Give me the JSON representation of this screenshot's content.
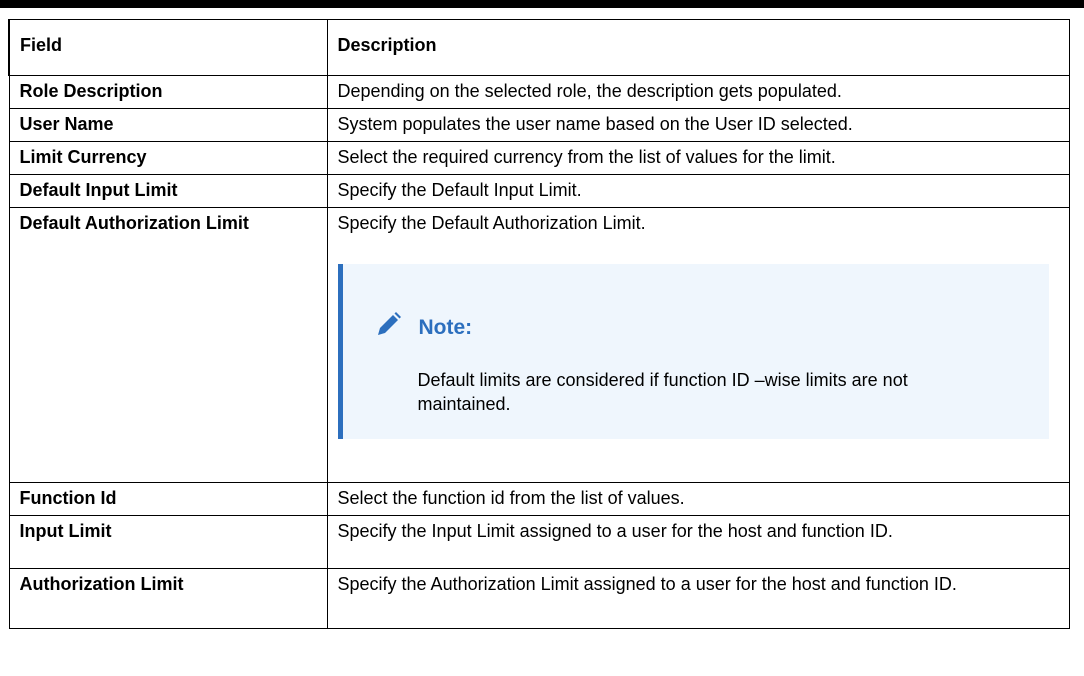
{
  "table": {
    "headers": {
      "field": "Field",
      "description": "Description"
    },
    "rows": [
      {
        "field": "Role Description",
        "description": "Depending on the selected role, the description gets populated."
      },
      {
        "field": "User Name",
        "description": "System populates the user name based on the User ID selected."
      },
      {
        "field": "Limit Currency",
        "description": "Select the required currency from the list of values for the limit."
      },
      {
        "field": "Default Input Limit",
        "description": "Specify the Default Input Limit."
      },
      {
        "field": "Default Authorization Limit",
        "description": "Specify the Default Authorization Limit.",
        "note": {
          "icon": "pencil-icon",
          "label": "Note:",
          "text": "Default limits are considered if function ID –wise limits are not maintained."
        }
      },
      {
        "field": "Function Id",
        "description": "Select the function id from the list of values."
      },
      {
        "field": "Input Limit",
        "description": "Specify the Input Limit assigned to a user for the host and function ID."
      },
      {
        "field": "Authorization Limit",
        "description": "Specify the Authorization Limit assigned to a user for the host and function ID."
      }
    ]
  },
  "colors": {
    "note_accent": "#2c6fbe",
    "note_background": "#eff6fd"
  }
}
